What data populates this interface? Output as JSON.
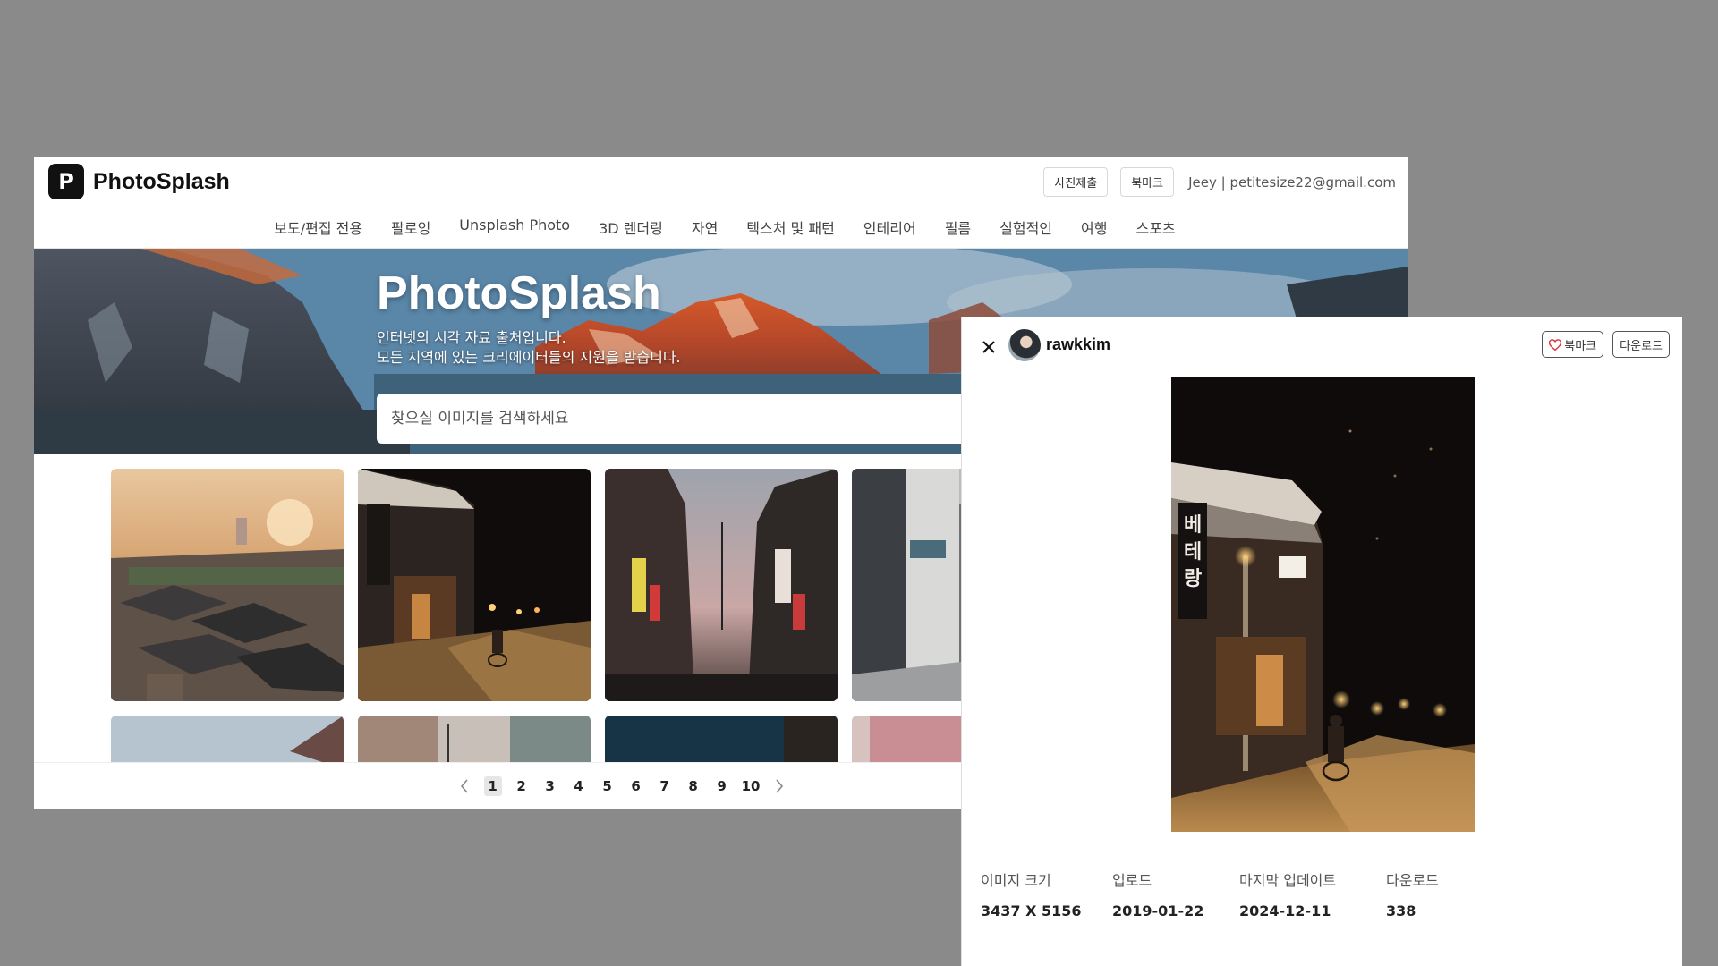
{
  "app": {
    "name": "PhotoSplash",
    "logo_letter": "P"
  },
  "header": {
    "submit_label": "사진제출",
    "bookmark_label": "북마크",
    "user_info": "Jeey | petitesize22@gmail.com"
  },
  "nav": {
    "items": [
      "보도/편집 전용",
      "팔로잉",
      "Unsplash Photo",
      "3D 렌더링",
      "자연",
      "텍스처 및 패턴",
      "인테리어",
      "필름",
      "실험적인",
      "여행",
      "스포츠"
    ]
  },
  "hero": {
    "title": "PhotoSplash",
    "subtitle_line1": "인터넷의 시각 자료 출처입니다.",
    "subtitle_line2": "모든 지역에 있는 크리에이터들의 지원을 받습니다.",
    "search_placeholder": "찾으실 이미지를 검색하세요"
  },
  "gallery": {
    "tiles": [
      {
        "subject": "hanok-village-sunset"
      },
      {
        "subject": "night-street-cyclist"
      },
      {
        "subject": "city-street-signs"
      },
      {
        "subject": "alley-buildings"
      },
      {
        "subject": "sky-partial"
      },
      {
        "subject": "buildings-partial"
      },
      {
        "subject": "dark-scene-partial"
      },
      {
        "subject": "pink-buildings-partial"
      }
    ]
  },
  "pagination": {
    "pages": [
      "1",
      "2",
      "3",
      "4",
      "5",
      "6",
      "7",
      "8",
      "9",
      "10"
    ],
    "current": "1"
  },
  "modal": {
    "username": "rawkkim",
    "bookmark_label": "북마크",
    "download_label": "다운로드",
    "photo_sign_text": "베테랑",
    "info": [
      {
        "label": "이미지 크기",
        "value": "3437 X 5156"
      },
      {
        "label": "업로드",
        "value": "2019-01-22"
      },
      {
        "label": "마지막 업데이트",
        "value": "2024-12-11"
      },
      {
        "label": "다운로드",
        "value": "338"
      }
    ]
  },
  "colors": {
    "background": "#8a8a8a",
    "heart": "#e0303a",
    "active_page": "#e6e6e6"
  }
}
